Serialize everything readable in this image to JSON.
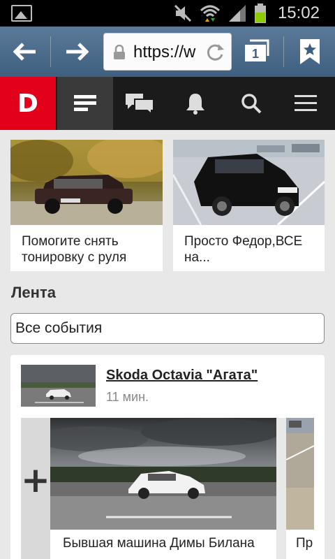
{
  "status_bar": {
    "time": "15:02",
    "icons": [
      "gallery-icon",
      "mute-icon",
      "wifi-icon",
      "signal-icon",
      "battery-icon"
    ]
  },
  "browser": {
    "url": "https://w",
    "tab_count": "1",
    "icons": [
      "back-arrow-icon",
      "forward-arrow-icon",
      "lock-icon",
      "reload-icon",
      "tabs-icon",
      "bookmark-icon"
    ]
  },
  "site_nav": {
    "logo": "D",
    "items": [
      "feed-icon",
      "messages-icon",
      "notifications-icon",
      "search-icon",
      "menu-icon"
    ],
    "active": "feed-icon"
  },
  "top_cards": [
    {
      "caption": "Помогите снять тонировку с руля"
    },
    {
      "caption": "Просто Федор,ВСЕ на..."
    }
  ],
  "feed": {
    "section_title": "Лента",
    "filter_value": "Все события",
    "post": {
      "title": "Skoda Octavia \"Агата\"",
      "time": "11 мин.",
      "add_label": "+",
      "gallery_main_caption": "Бывшая машина Димы Билана",
      "gallery_next_caption": "Пр вы"
    }
  },
  "colors": {
    "brand_red": "#e2001a",
    "nav_bg": "#1b1b1b",
    "browser_bar": "#4d6d8e"
  }
}
